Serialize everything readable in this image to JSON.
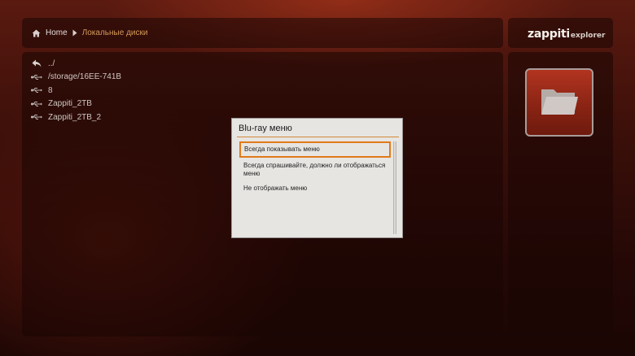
{
  "breadcrumb": {
    "home_label": "Home",
    "current_label": "Локальные диски"
  },
  "logo": {
    "brand": "zappiti",
    "sub": "explorer"
  },
  "file_list": [
    {
      "label": "../",
      "icon": "back-arrow-icon"
    },
    {
      "label": "/storage/16EE-741B",
      "icon": "usb-icon"
    },
    {
      "label": "8",
      "icon": "usb-icon"
    },
    {
      "label": "Zappiti_2TB",
      "icon": "usb-icon"
    },
    {
      "label": "Zappiti_2TB_2",
      "icon": "usb-icon"
    }
  ],
  "dialog": {
    "title": "Blu-ray меню",
    "options": [
      {
        "label": "Всегда показывать меню",
        "selected": true
      },
      {
        "label": "Всегда спрашивайте, должно ли отображаться меню",
        "selected": false
      },
      {
        "label": "Не отображать меню",
        "selected": false
      }
    ]
  },
  "side_panel": {
    "icon": "folder-icon"
  },
  "colors": {
    "accent": "#e07a1a",
    "breadcrumb_current": "#d49a5a",
    "tile": "#9a2a18"
  }
}
